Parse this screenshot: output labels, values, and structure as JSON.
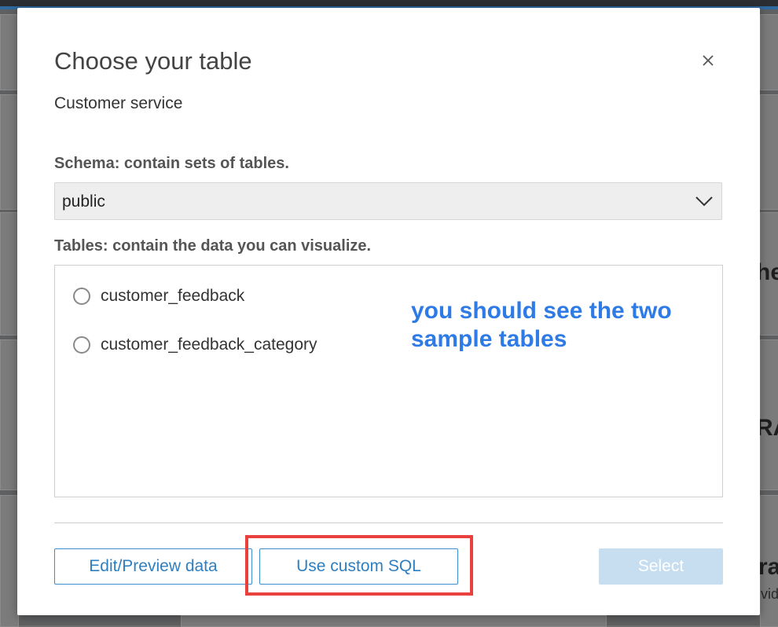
{
  "modal": {
    "title": "Choose your table",
    "subtitle": "Customer service",
    "close_icon": "close-icon"
  },
  "schema": {
    "label": "Schema: contain sets of tables.",
    "selected": "public"
  },
  "tables": {
    "label": "Tables: contain the data you can visualize.",
    "items": [
      {
        "label": "customer_feedback",
        "selected": false
      },
      {
        "label": "customer_feedback_category",
        "selected": false
      }
    ]
  },
  "annotation": {
    "text": "you should see the two sample tables",
    "color": "#2e7be6"
  },
  "buttons": {
    "edit_preview": "Edit/Preview data",
    "custom_sql": "Use custom SQL",
    "select": "Select"
  },
  "background": {
    "fragment_1": "he",
    "fragment_2": "RA",
    "fragment_3": "ra",
    "fragment_4": "vid"
  },
  "colors": {
    "accent": "#2f7fc0",
    "highlight": "#e8413e",
    "disabled_button": "#c7def0"
  }
}
